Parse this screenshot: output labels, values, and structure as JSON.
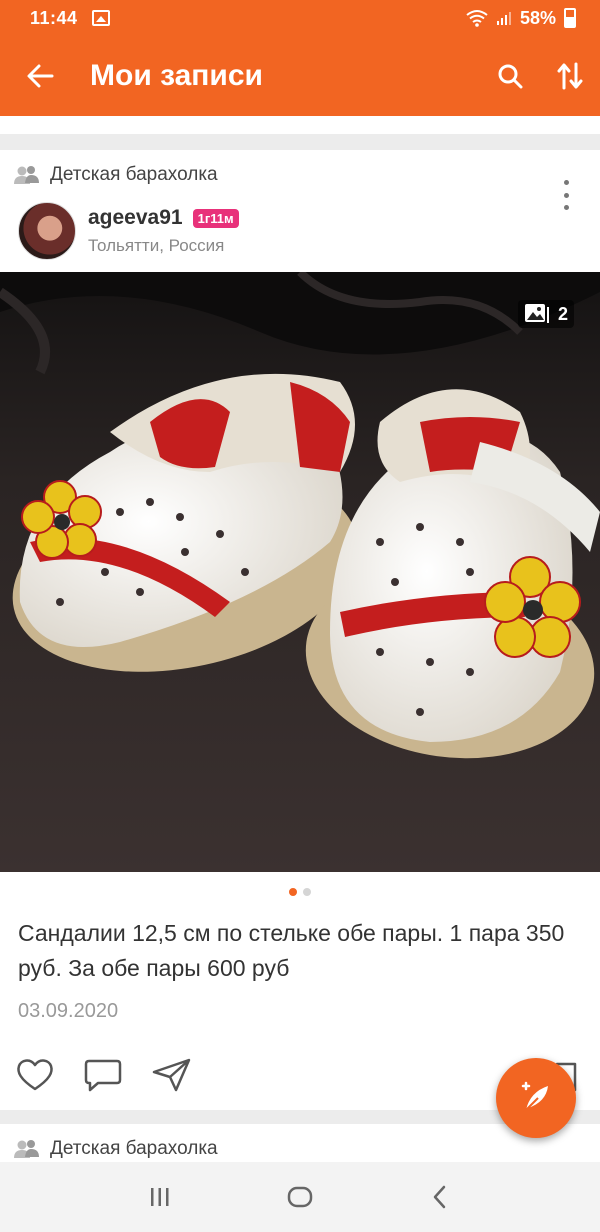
{
  "status_bar": {
    "time": "11:44",
    "battery": "58%"
  },
  "app_bar": {
    "title": "Мои записи"
  },
  "post": {
    "group": "Детская барахолка",
    "author": {
      "name": "ageeva91",
      "badge": "1г11м",
      "location": "Тольятти, Россия"
    },
    "photo_count": "2",
    "text": "Сандалии 12,5 см по стельке обе пары. 1 пара 350 руб. За обе пары 600 руб",
    "date": "03.09.2020"
  },
  "next_post": {
    "group": "Детская барахолка"
  },
  "colors": {
    "accent": "#f26522",
    "badge": "#e8317a"
  }
}
